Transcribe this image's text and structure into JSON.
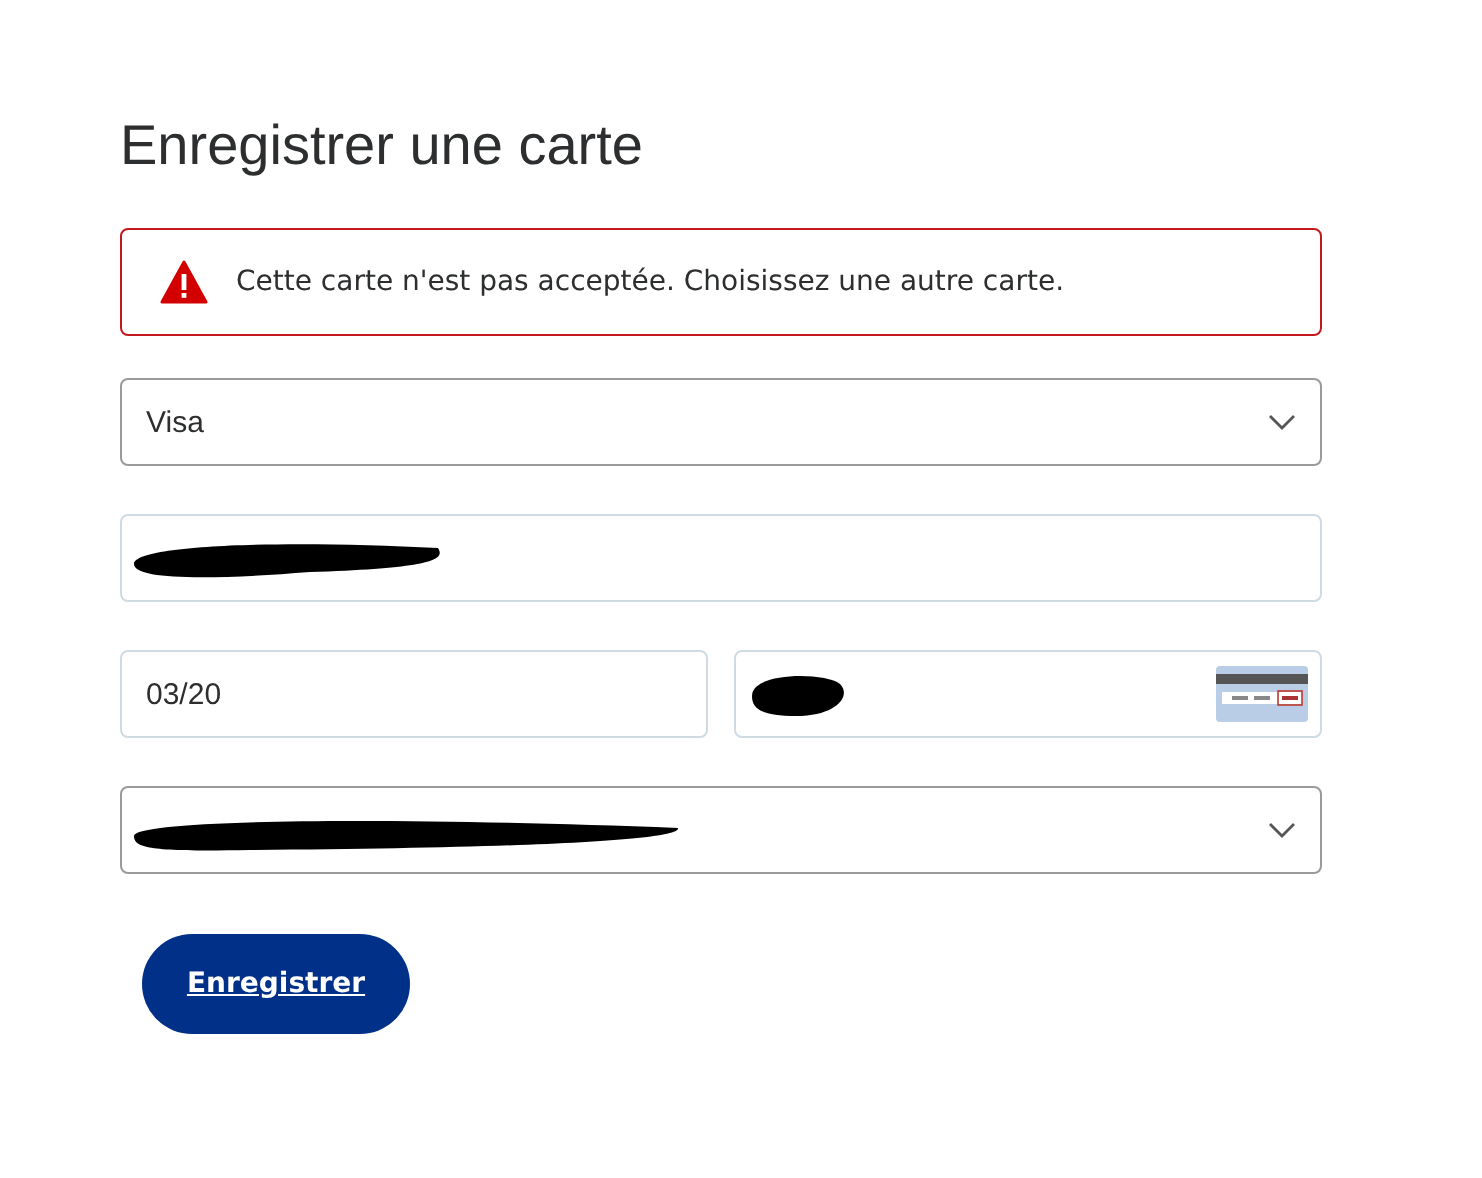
{
  "title": "Enregistrer une carte",
  "error": {
    "message": "Cette carte n'est pas acceptée. Choisissez une autre carte."
  },
  "rows": [
    [
      {
        "kind": "select",
        "value": "Visa",
        "redacted": false
      }
    ],
    [
      {
        "kind": "input",
        "redacted": true
      }
    ],
    [
      {
        "kind": "input",
        "value": "03/20",
        "redacted": false
      },
      {
        "kind": "cvv",
        "redacted": true
      }
    ],
    [
      {
        "kind": "select",
        "redacted": true
      }
    ]
  ],
  "button": {
    "label": "Enregistrer"
  }
}
